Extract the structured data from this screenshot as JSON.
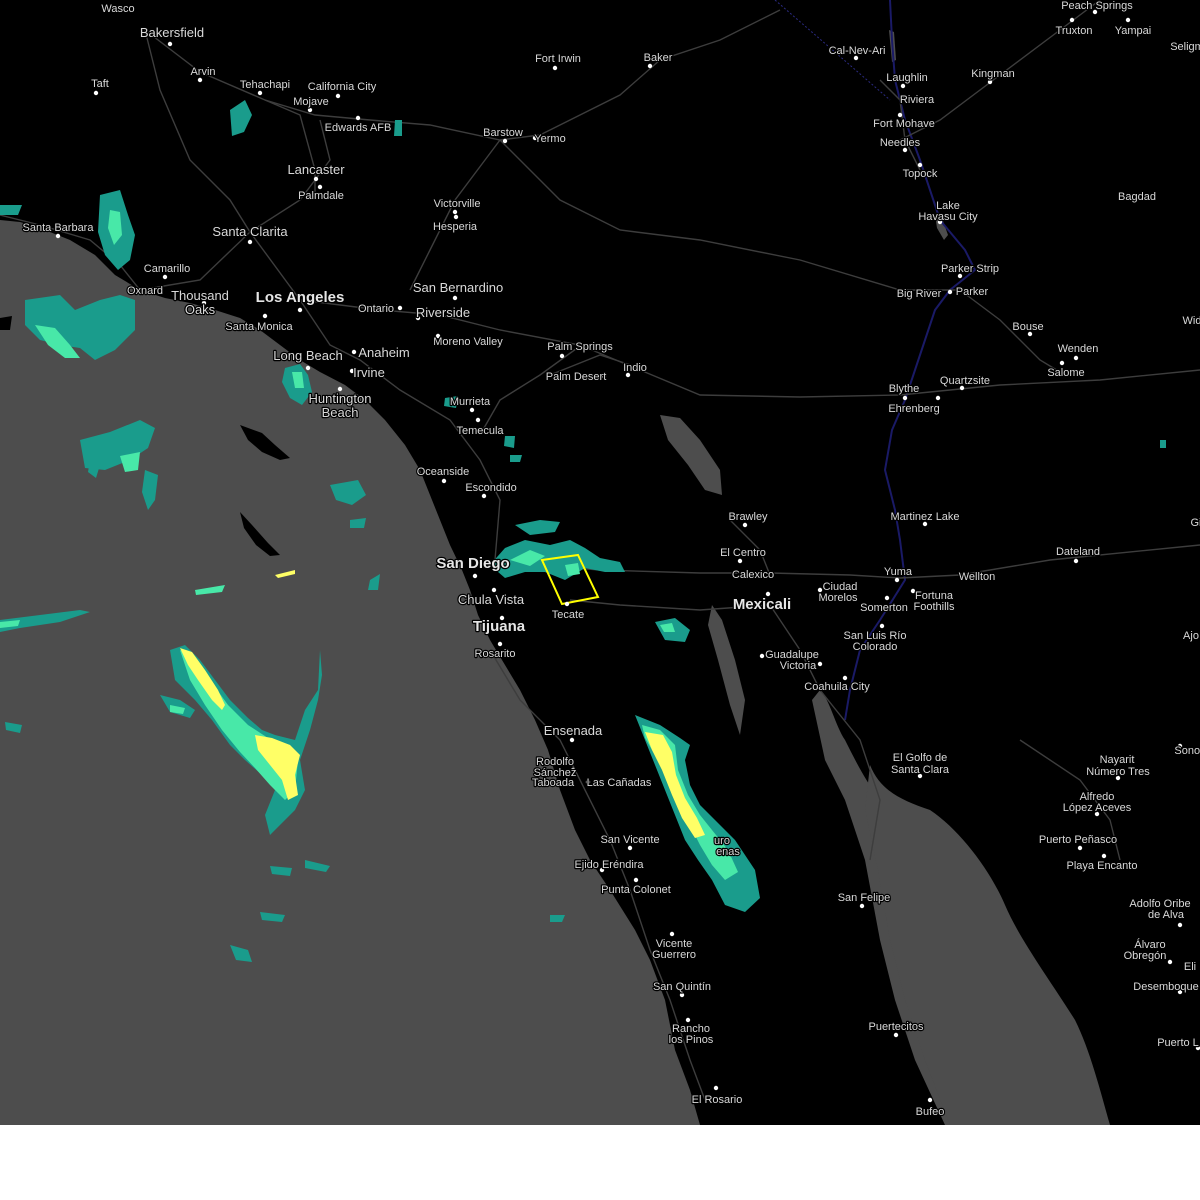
{
  "map": {
    "land_color": "#000000",
    "ocean_color": "#4d4d4d",
    "lake_color": "#4d4d4d",
    "road_color": "#404040",
    "river_color": "#1a1a66",
    "warning_polygon_color": "#ffff00",
    "radar_palette": [
      "#1a9c8c",
      "#48e8a8",
      "#ffff66"
    ]
  },
  "places": [
    {
      "name": "Wasco",
      "size": "small"
    },
    {
      "name": "Bakersfield",
      "size": "medium"
    },
    {
      "name": "Arvin",
      "size": "small"
    },
    {
      "name": "Taft",
      "size": "small"
    },
    {
      "name": "Tehachapi",
      "size": "small"
    },
    {
      "name": "California City",
      "size": "small"
    },
    {
      "name": "Mojave",
      "size": "small"
    },
    {
      "name": "Edwards AFB",
      "size": "small"
    },
    {
      "name": "Fort Irwin",
      "size": "small"
    },
    {
      "name": "Baker",
      "size": "small"
    },
    {
      "name": "Cal-Nev-Ari",
      "size": "small"
    },
    {
      "name": "Laughlin",
      "size": "small"
    },
    {
      "name": "Riviera",
      "size": "small"
    },
    {
      "name": "Fort Mohave",
      "size": "small"
    },
    {
      "name": "Needles",
      "size": "small"
    },
    {
      "name": "Topock",
      "size": "small"
    },
    {
      "name": "Kingman",
      "size": "small"
    },
    {
      "name": "Peach Springs",
      "size": "small"
    },
    {
      "name": "Truxton",
      "size": "small"
    },
    {
      "name": "Yampai",
      "size": "small"
    },
    {
      "name": "Seligm",
      "size": "small"
    },
    {
      "name": "Lancaster",
      "size": "medium"
    },
    {
      "name": "Palmdale",
      "size": "small"
    },
    {
      "name": "Barstow",
      "size": "small"
    },
    {
      "name": "Yermo",
      "size": "small"
    },
    {
      "name": "Victorville",
      "size": "small"
    },
    {
      "name": "Hesperia",
      "size": "small"
    },
    {
      "name": "Lake",
      "size": "small"
    },
    {
      "name": "Havasu City",
      "size": "small"
    },
    {
      "name": "Bagdad",
      "size": "small"
    },
    {
      "name": "Santa Barbara",
      "size": "small"
    },
    {
      "name": "Santa Clarita",
      "size": "medium"
    },
    {
      "name": "Camarillo",
      "size": "small"
    },
    {
      "name": "Oxnard",
      "size": "small"
    },
    {
      "name": "Thousand",
      "size": "medium"
    },
    {
      "name": "Oaks",
      "size": "medium"
    },
    {
      "name": "Los Angeles",
      "size": "large"
    },
    {
      "name": "Santa Monica",
      "size": "small"
    },
    {
      "name": "San Bernardino",
      "size": "medium"
    },
    {
      "name": "Ontario",
      "size": "small"
    },
    {
      "name": "Riverside",
      "size": "medium"
    },
    {
      "name": "Moreno Valley",
      "size": "small"
    },
    {
      "name": "Parker Strip",
      "size": "small"
    },
    {
      "name": "Big River",
      "size": "small"
    },
    {
      "name": "Parker",
      "size": "small"
    },
    {
      "name": "Bouse",
      "size": "small"
    },
    {
      "name": "Wenden",
      "size": "small"
    },
    {
      "name": "Salome",
      "size": "small"
    },
    {
      "name": "Palm Springs",
      "size": "small"
    },
    {
      "name": "Palm Desert",
      "size": "small"
    },
    {
      "name": "Indio",
      "size": "small"
    },
    {
      "name": "Long Beach",
      "size": "medium"
    },
    {
      "name": "Anaheim",
      "size": "medium"
    },
    {
      "name": "Irvine",
      "size": "medium"
    },
    {
      "name": "Huntington",
      "size": "medium"
    },
    {
      "name": "Beach",
      "size": "medium"
    },
    {
      "name": "Murrieta",
      "size": "small"
    },
    {
      "name": "Temecula",
      "size": "small"
    },
    {
      "name": "Blythe",
      "size": "small"
    },
    {
      "name": "Ehrenberg",
      "size": "small"
    },
    {
      "name": "Quartzsite",
      "size": "small"
    },
    {
      "name": "Oceanside",
      "size": "small"
    },
    {
      "name": "Escondido",
      "size": "small"
    },
    {
      "name": "Brawley",
      "size": "small"
    },
    {
      "name": "Martinez Lake",
      "size": "small"
    },
    {
      "name": "El Centro",
      "size": "small"
    },
    {
      "name": "Dateland",
      "size": "small"
    },
    {
      "name": "San Diego",
      "size": "large"
    },
    {
      "name": "Calexico",
      "size": "small"
    },
    {
      "name": "Yuma",
      "size": "small"
    },
    {
      "name": "Wellton",
      "size": "small"
    },
    {
      "name": "Ciudad",
      "size": "small"
    },
    {
      "name": "Morelos",
      "size": "small"
    },
    {
      "name": "Fortuna",
      "size": "small"
    },
    {
      "name": "Foothills",
      "size": "small"
    },
    {
      "name": "Somerton",
      "size": "small"
    },
    {
      "name": "Chula Vista",
      "size": "medium"
    },
    {
      "name": "Mexicali",
      "size": "large"
    },
    {
      "name": "Tecate",
      "size": "small"
    },
    {
      "name": "Tijuana",
      "size": "large"
    },
    {
      "name": "San Luis Río",
      "size": "small"
    },
    {
      "name": "Colorado",
      "size": "small"
    },
    {
      "name": "Rosarito",
      "size": "small"
    },
    {
      "name": "Guadalupe",
      "size": "small"
    },
    {
      "name": "Victoria",
      "size": "small"
    },
    {
      "name": "Coahuila City",
      "size": "small"
    },
    {
      "name": "Ajo",
      "size": "small"
    },
    {
      "name": "Ensenada",
      "size": "medium"
    },
    {
      "name": "El Golfo de",
      "size": "small"
    },
    {
      "name": "Santa Clara",
      "size": "small"
    },
    {
      "name": "Nayarit",
      "size": "small"
    },
    {
      "name": "Número Tres",
      "size": "small"
    },
    {
      "name": "Sonoy",
      "size": "small"
    },
    {
      "name": "Rodolfo",
      "size": "small"
    },
    {
      "name": "Sánchez",
      "size": "small"
    },
    {
      "name": "Taboada",
      "size": "small"
    },
    {
      "name": "Las Cañadas",
      "size": "small"
    },
    {
      "name": "Alfredo",
      "size": "small"
    },
    {
      "name": "López Aceves",
      "size": "small"
    },
    {
      "name": "San Vicente",
      "size": "small"
    },
    {
      "name": "Puerto Peñasco",
      "size": "small"
    },
    {
      "name": "uro",
      "size": "small"
    },
    {
      "name": "enas",
      "size": "small"
    },
    {
      "name": "Playa Encanto",
      "size": "small"
    },
    {
      "name": "Ejido Eréndira",
      "size": "small"
    },
    {
      "name": "Punta Colonet",
      "size": "small"
    },
    {
      "name": "San Felipe",
      "size": "small"
    },
    {
      "name": "Adolfo Oribe",
      "size": "small"
    },
    {
      "name": "de Alva",
      "size": "small"
    },
    {
      "name": "Vicente",
      "size": "small"
    },
    {
      "name": "Guerrero",
      "size": "small"
    },
    {
      "name": "Álvaro",
      "size": "small"
    },
    {
      "name": "Obregón",
      "size": "small"
    },
    {
      "name": "Eli",
      "size": "small"
    },
    {
      "name": "San Quintín",
      "size": "small"
    },
    {
      "name": "Desemboque",
      "size": "small"
    },
    {
      "name": "Rancho",
      "size": "small"
    },
    {
      "name": "los Pinos",
      "size": "small"
    },
    {
      "name": "Puertecitos",
      "size": "small"
    },
    {
      "name": "Puerto L",
      "size": "small"
    },
    {
      "name": "El Rosario",
      "size": "small"
    },
    {
      "name": "Bufeo",
      "size": "small"
    },
    {
      "name": "Wid",
      "size": "small"
    },
    {
      "name": "Gi",
      "size": "small"
    }
  ]
}
